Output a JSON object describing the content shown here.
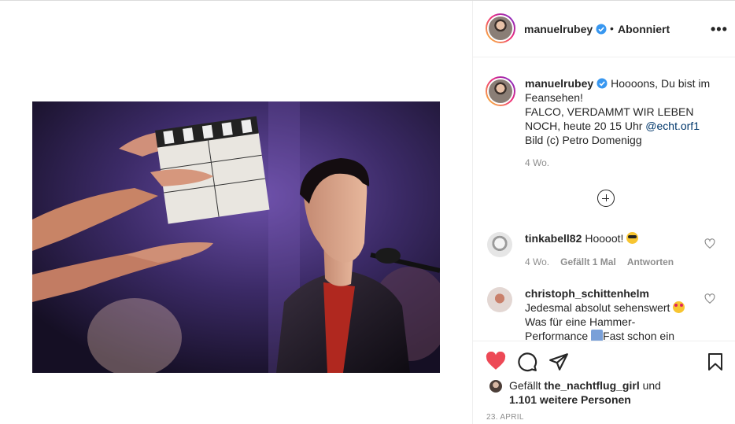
{
  "post": {
    "image_alt": "Filmszene Falco"
  },
  "header": {
    "username": "manuelrubey",
    "separator": "•",
    "follow_status": "Abonniert",
    "more": "•••"
  },
  "caption": {
    "username": "manuelrubey",
    "text_1": "Hoooons, Du bist im Feansehen!",
    "text_2": "FALCO, VERDAMMT WIR LEBEN NOCH, heute 20 15 Uhr ",
    "mention": "@echt.orf1",
    "text_3": "Bild (c) Petro Domenigg",
    "age": "4 Wo."
  },
  "comments": [
    {
      "username": "tinkabell82",
      "text": "Hoooot!",
      "emoji": "sunglasses-emoji",
      "age": "4 Wo.",
      "likes": "Gefällt 1 Mal",
      "reply": "Antworten"
    },
    {
      "username": "christoph_schittenhelm",
      "text_1": "Jedesmal absolut sehenswert",
      "emoji": "heart-eyes-emoji",
      "text_2": "Was für eine Hammer-",
      "text_3": "Performance",
      "text_4": "Fast schon ein"
    }
  ],
  "likes": {
    "prefix": "Gefällt ",
    "user": "the_nachtflug_girl",
    "middle": " und",
    "others": "1.101 weitere Personen"
  },
  "date": "23. APRIL",
  "colors": {
    "like_red": "#ed4956",
    "link_blue": "#00376b",
    "verified_blue": "#3897f0",
    "muted": "#8e8e8e"
  }
}
